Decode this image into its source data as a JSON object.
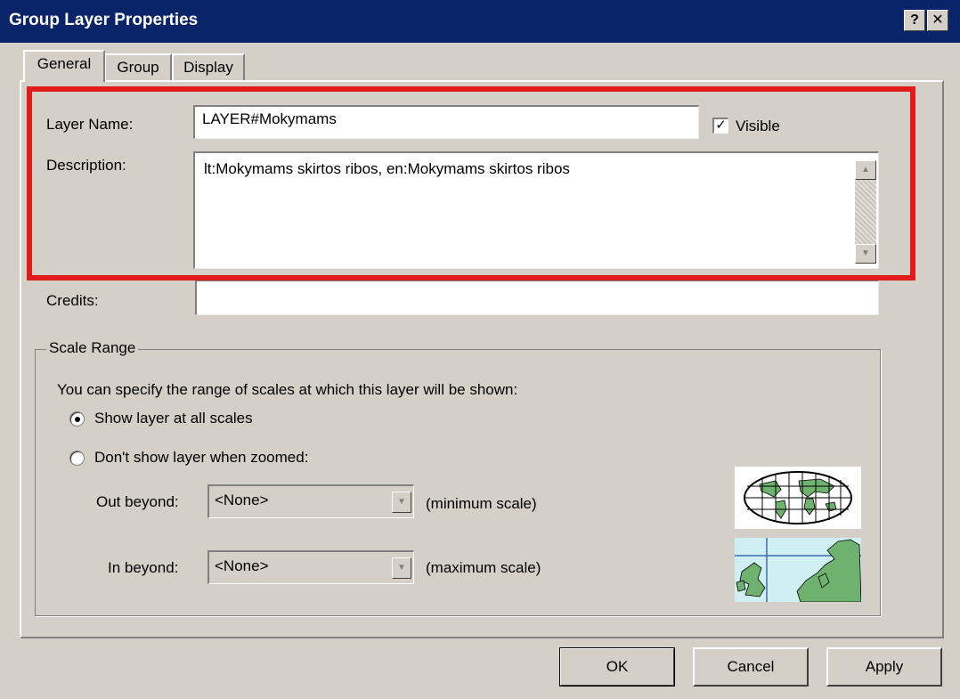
{
  "window": {
    "title": "Group Layer Properties",
    "help_label": "?",
    "close_label": "✕"
  },
  "tabs": [
    {
      "label": "General",
      "active": true
    },
    {
      "label": "Group",
      "active": false
    },
    {
      "label": "Display",
      "active": false
    }
  ],
  "general": {
    "layer_name_label": "Layer Name:",
    "layer_name_value": "LAYER#Mokymams",
    "visible_label": "Visible",
    "visible_checked": true,
    "description_label": "Description:",
    "description_value": "lt:Mokymams skirtos ribos, en:Mokymams skirtos ribos",
    "credits_label": "Credits:",
    "credits_value": ""
  },
  "scale_range": {
    "title": "Scale Range",
    "instructions": "You can specify the range of scales at which this layer will be shown:",
    "option_all_scales": "Show layer at all scales",
    "option_zoomed": "Don't show layer when zoomed:",
    "selected_option": "all_scales",
    "out_beyond_label": "Out beyond:",
    "out_beyond_value": "<None>",
    "out_beyond_hint": "(minimum scale)",
    "in_beyond_label": "In beyond:",
    "in_beyond_value": "<None>",
    "in_beyond_hint": "(maximum scale)"
  },
  "buttons": {
    "ok": "OK",
    "cancel": "Cancel",
    "apply": "Apply"
  },
  "colors": {
    "titlebar": "#0a246a",
    "dialog_bg": "#d4d0c8",
    "highlight": "#e21b1b"
  }
}
